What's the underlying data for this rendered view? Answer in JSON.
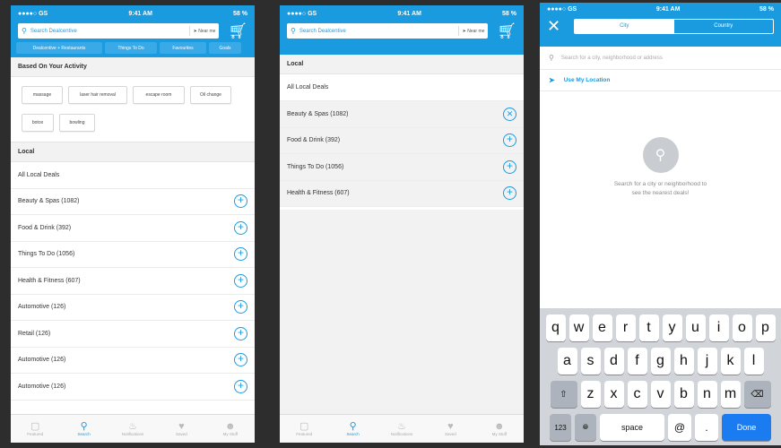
{
  "status": {
    "carrier": "●●●●○ GS",
    "time": "9:41 AM",
    "battery": "58 %"
  },
  "search": {
    "placeholder": "Search Dealcentive",
    "near_me": "Near me"
  },
  "chips": [
    "Dealcentive + Restaurants",
    "Things To Do",
    "Favourites",
    "Goals"
  ],
  "activity": {
    "title": "Based On Your Activity",
    "tags": [
      "massage",
      "laser hair removal",
      "escape room",
      "Oil change",
      "botox",
      "bowling"
    ]
  },
  "local": {
    "title": "Local",
    "all": "All Local Deals",
    "categories_p1": [
      "Beauty & Spas (1082)",
      "Food & Drink (392)",
      "Things To Do (1056)",
      "Health & Fitness (607)",
      "Automotive (126)",
      "Retail (126)",
      "Automotive (126)",
      "Automotive (126)"
    ],
    "categories_p2": [
      "Beauty & Spas (1082)",
      "Food & Drink (392)",
      "Things To Do (1056)",
      "Health & Fitness (607)"
    ]
  },
  "tabs": [
    {
      "label": "Featured",
      "icon": "featured-icon"
    },
    {
      "label": "Search",
      "icon": "search-icon"
    },
    {
      "label": "Notifications",
      "icon": "bell-icon"
    },
    {
      "label": "Saved",
      "icon": "heart-icon"
    },
    {
      "label": "My Stuff",
      "icon": "person-icon"
    }
  ],
  "location": {
    "seg_city": "City",
    "seg_country": "Country",
    "placeholder": "Search for a city, neighborhood or address",
    "use_location": "Use My Location",
    "empty_text": "Search for a city or neighborhood to see the nearest deals!"
  },
  "keyboard": {
    "row1": [
      "q",
      "w",
      "e",
      "r",
      "t",
      "y",
      "u",
      "i",
      "o",
      "p"
    ],
    "row2": [
      "a",
      "s",
      "d",
      "f",
      "g",
      "h",
      "j",
      "k",
      "l"
    ],
    "row3": [
      "z",
      "x",
      "c",
      "v",
      "b",
      "n",
      "m"
    ],
    "numbers": "123",
    "space": "space",
    "at": "@",
    "dot": ".",
    "done": "Done"
  },
  "colors": {
    "accent": "#1a9be0",
    "done_key": "#1a7cf0"
  }
}
